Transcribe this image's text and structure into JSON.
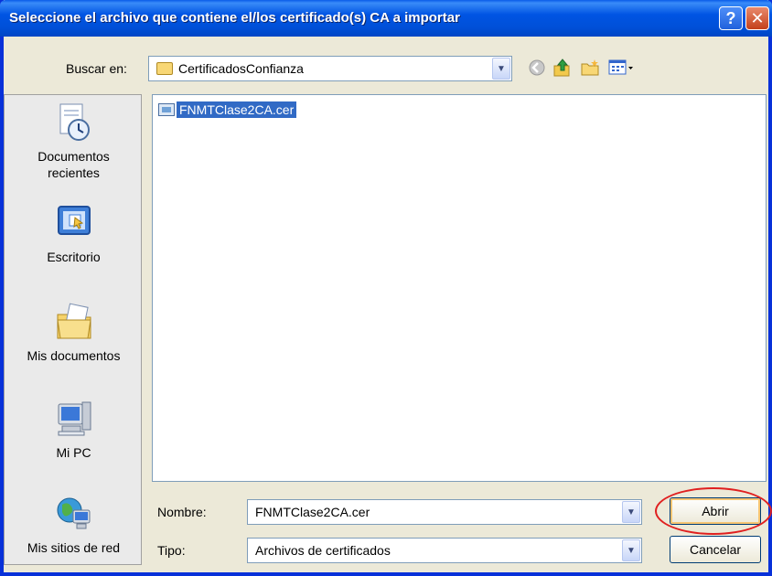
{
  "window": {
    "title": "Seleccione el archivo que contiene el/los certificado(s) CA a importar",
    "help_label": "?",
    "close_label": "✕"
  },
  "lookin": {
    "label": "Buscar en:",
    "value": "CertificadosConfianza"
  },
  "toolbar": {
    "icons": [
      "back-icon",
      "up-folder-icon",
      "new-folder-icon",
      "view-menu-icon"
    ]
  },
  "places": [
    {
      "label_line1": "Documentos",
      "label_line2": "recientes",
      "icon": "recent-documents-icon"
    },
    {
      "label_line1": "Escritorio",
      "label_line2": "",
      "icon": "desktop-icon"
    },
    {
      "label_line1": "Mis documentos",
      "label_line2": "",
      "icon": "my-documents-icon"
    },
    {
      "label_line1": "Mi PC",
      "label_line2": "",
      "icon": "my-computer-icon"
    },
    {
      "label_line1": "Mis sitios de red",
      "label_line2": "",
      "icon": "network-places-icon"
    }
  ],
  "files": [
    {
      "name": "FNMTClase2CA.cer",
      "selected": true
    }
  ],
  "filename": {
    "label": "Nombre:",
    "value": "FNMTClase2CA.cer"
  },
  "filetype": {
    "label": "Tipo:",
    "value": "Archivos de certificados"
  },
  "buttons": {
    "open_label": "Abrir",
    "cancel_label": "Cancelar"
  },
  "colors": {
    "titlebar": "#0054e3",
    "selection": "#316ac5",
    "annotation": "#e02020"
  }
}
